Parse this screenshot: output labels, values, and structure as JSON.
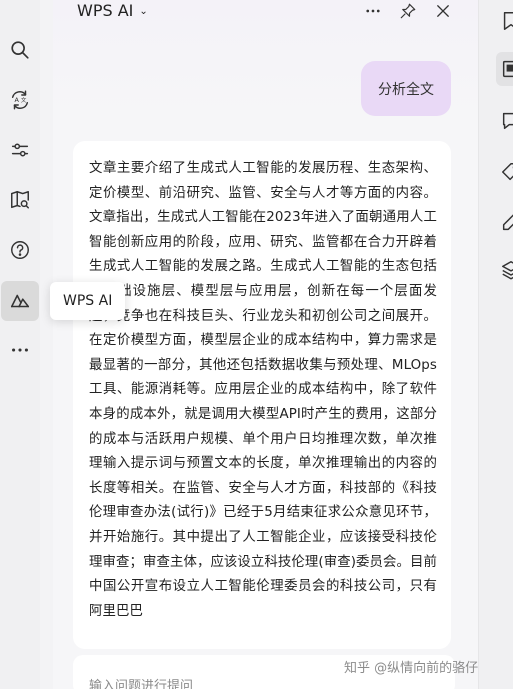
{
  "sidebar": {
    "items": [
      {
        "name": "search-icon"
      },
      {
        "name": "translate-icon"
      },
      {
        "name": "sliders-icon"
      },
      {
        "name": "book-search-icon"
      },
      {
        "name": "help-icon"
      },
      {
        "name": "wps-ai-icon"
      },
      {
        "name": "more-icon"
      }
    ],
    "active_index": 5,
    "tooltip": "WPS AI"
  },
  "panel": {
    "title": "WPS AI",
    "title_chevron": "⌄",
    "header_icons": [
      "more-icon",
      "pin-icon",
      "close-icon"
    ]
  },
  "chat": {
    "user_message": "分析全文",
    "answer": "文章主要介绍了生成式人工智能的发展历程、生态架构、定价模型、前沿研究、监管、安全与人才等方面的内容。文章指出，生成式人工智能在2023年进入了面朝通用人工智能创新应用的阶段，应用、研究、监管都在合力开辟着生成式人工智能的发展之路。生成式人工智能的生态包括了基础设施层、模型层与应用层，创新在每一个层面发起，竞争也在科技巨头、行业龙头和初创公司之间展开。在定价模型方面，模型层企业的成本结构中，算力需求是最显著的一部分，其他还包括数据收集与预处理、MLOps工具、能源消耗等。应用层企业的成本结构中，除了软件本身的成本外，就是调用大模型API时产生的费用，这部分的成本与活跃用户规模、单个用户日均推理次数，单次推理输入提示词与预置文本的长度，单次推理输出的内容的长度等相关。在监管、安全与人才方面，科技部的《科技伦理审查办法(试行)》已经于5月结束征求公众意见环节，并开始施行。其中提出了人工智能企业，应该接受科技伦理审查；审查主体，应该设立科技伦理(审查)委员会。目前中国公开宣布设立人工智能伦理委员会的科技公司，只有阿里巴巴"
  },
  "input": {
    "placeholder": "输入问题进行提问"
  },
  "watermark": "知乎 @纵情向前的骆仔",
  "right_rail": {
    "icons": [
      "bookmark-icon",
      "document-panel-icon",
      "comment-icon",
      "tag-icon",
      "edit-icon",
      "layers-icon"
    ],
    "active_index": 1
  },
  "colors": {
    "user_bubble": "#e9d9f6",
    "accent": "#7a4fd6",
    "rail_bg": "#f0f0f2"
  }
}
